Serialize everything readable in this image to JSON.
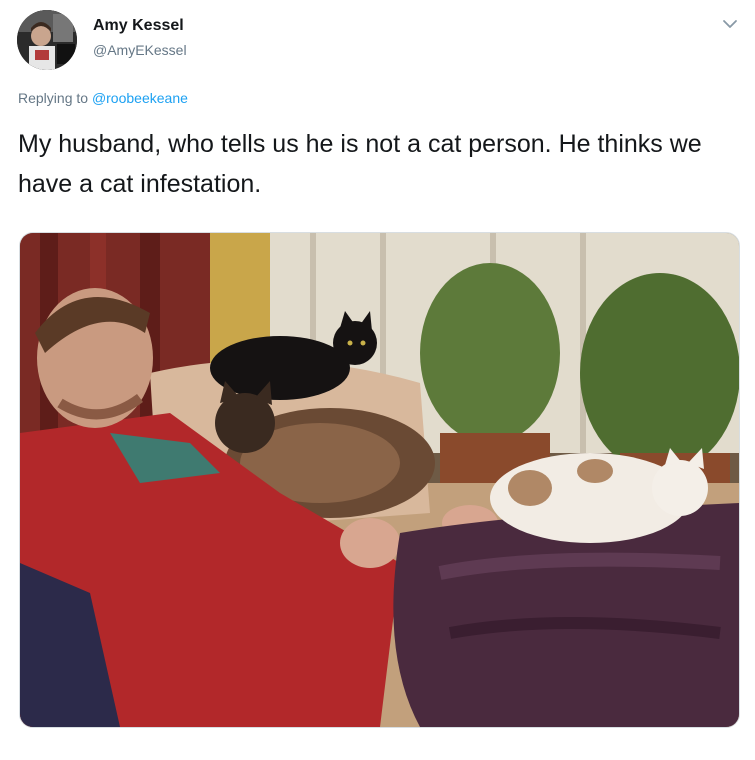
{
  "author": {
    "display_name": "Amy Kessel",
    "handle": "@AmyEKessel"
  },
  "reply": {
    "prefix": "Replying to",
    "mention": "@roobeekeane"
  },
  "tweet": {
    "text": "My husband, who tells us he is not a cat person.  He thinks we have a cat infestation."
  },
  "icons": {
    "caret": "chevron-down-icon",
    "avatar": "avatar-image"
  },
  "colors": {
    "accent": "#1da1f2",
    "secondary_text": "#657786",
    "primary_text": "#14171a"
  }
}
